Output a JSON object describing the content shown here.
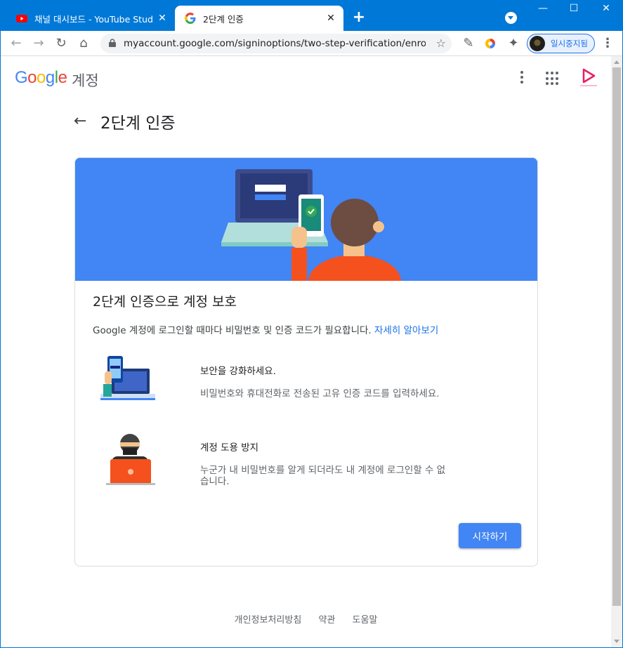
{
  "browser": {
    "tabs": [
      {
        "title": "채널 대시보드 - YouTube Studio",
        "active": false,
        "favicon": "youtube-icon"
      },
      {
        "title": "2단계 인증",
        "active": true,
        "favicon": "google-g-icon"
      }
    ],
    "url": "myaccount.google.com/signinoptions/two-step-verification/enroll...",
    "profile_label": "일시중지됨"
  },
  "header": {
    "logo": [
      "G",
      "o",
      "o",
      "g",
      "l",
      "e"
    ],
    "logo_colors": [
      "#4285f4",
      "#ea4335",
      "#fbbc05",
      "#4285f4",
      "#34a853",
      "#ea4335"
    ],
    "account_label": "계정"
  },
  "page": {
    "title": "2단계 인증"
  },
  "card": {
    "heading": "2단계 인증으로 계정 보호",
    "description": "Google 계정에 로그인할 때마다 비밀번호 및 인증 코드가 필요합니다.",
    "learn_more": "자세히 알아보기",
    "features": [
      {
        "title": "보안을 강화하세요.",
        "desc": "비밀번호와 휴대전화로 전송된 고유 인증 코드를 입력하세요.",
        "icon": "phone-laptop-illustration"
      },
      {
        "title": "계정 도용 방지",
        "desc": "누군가 내 비밀번호를 알게 되더라도 내 계정에 로그인할 수 없습니다.",
        "icon": "hacker-illustration"
      }
    ],
    "start_button": "시작하기"
  },
  "footer": {
    "links": [
      "개인정보처리방침",
      "약관",
      "도움말"
    ]
  },
  "colors": {
    "accent": "#4285f4",
    "link": "#1a73e8",
    "titlebar": "#0078d7"
  }
}
